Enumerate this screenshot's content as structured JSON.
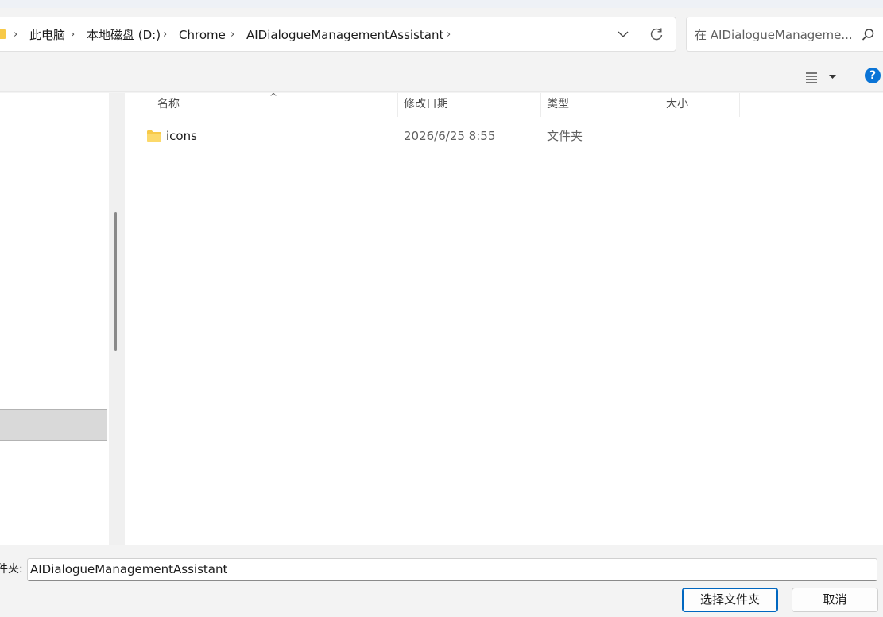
{
  "address_bar": {
    "crumbs": [
      "此电脑",
      "本地磁盘 (D:)",
      "Chrome",
      "AIDialogueManagementAssistant"
    ]
  },
  "search": {
    "placeholder": "在 AIDialogueManageme..."
  },
  "toolbar": {
    "help_label": "?"
  },
  "columns": {
    "name": "名称",
    "modified": "修改日期",
    "type": "类型",
    "size": "大小"
  },
  "files": [
    {
      "name": "icons",
      "modified": "2026/6/25 8:55",
      "type": "文件夹",
      "size": ""
    }
  ],
  "footer": {
    "folder_label": "件夹:",
    "folder_value": "AIDialogueManagementAssistant",
    "select_button": "选择文件夹",
    "cancel_button": "取消"
  },
  "colors": {
    "folder": "#f7c948",
    "accent": "#0067c0",
    "help": "#0a74d6"
  }
}
